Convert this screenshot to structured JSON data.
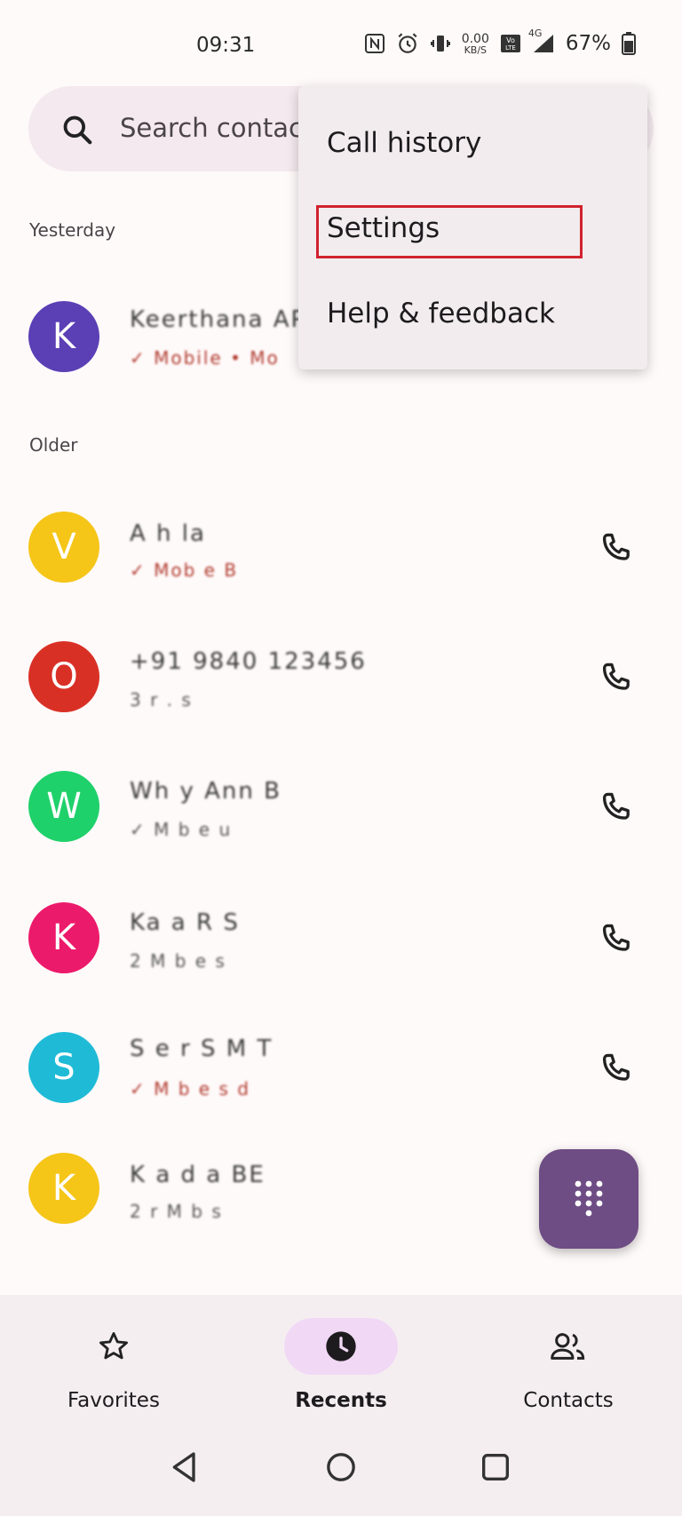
{
  "status_bar": {
    "time": "09:31",
    "net_speed_value": "0.00",
    "net_speed_unit": "KB/S",
    "network_label": "4G",
    "battery": "67%"
  },
  "search": {
    "placeholder": "Search contacts"
  },
  "sections": {
    "yesterday": "Yesterday",
    "older": "Older"
  },
  "calls": [
    {
      "initial": "K",
      "color": "#5b3fb5",
      "name": "Keerthana AP",
      "detail": "✓ Mobile • Mo"
    },
    {
      "initial": "V",
      "color": "#f5c518",
      "name": "A   h  la",
      "detail": "✓ Mob   e  B"
    },
    {
      "initial": "O",
      "color": "#d93025",
      "name": "+91 9840 123456",
      "detail": "3   r   . s"
    },
    {
      "initial": "W",
      "color": "#1fd16a",
      "name": "Wh  y Ann  B",
      "detail": "✓ M  b  e  u"
    },
    {
      "initial": "K",
      "color": "#ec1a6a",
      "name": "Ka  a  R  S",
      "detail": "2  M  b  e  s"
    },
    {
      "initial": "S",
      "color": "#1fbbd6",
      "name": "S  e   r  S  M  T",
      "detail": "✓ M  b  e  s  d"
    },
    {
      "initial": "K",
      "color": "#f5c518",
      "name": "K  a   d   a  BE",
      "detail": "2  r  M  b  s"
    }
  ],
  "menu": {
    "call_history": "Call history",
    "settings": "Settings",
    "help_feedback": "Help & feedback"
  },
  "nav": {
    "favorites": "Favorites",
    "recents": "Recents",
    "contacts": "Contacts"
  },
  "colors": {
    "accent": "#6e4c84",
    "highlight": "#d0222e",
    "active_pill": "#f1d9f5"
  }
}
